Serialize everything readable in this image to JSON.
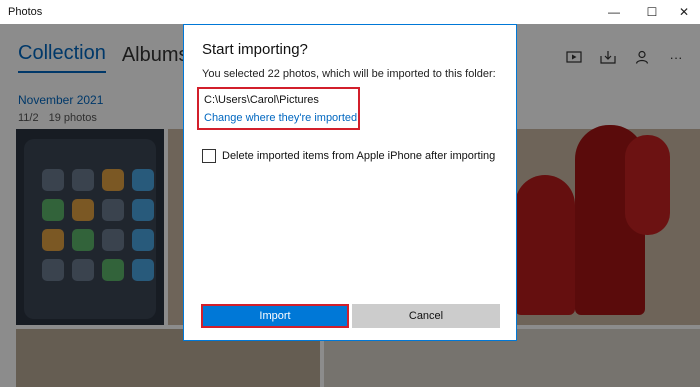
{
  "window": {
    "title": "Photos",
    "minimize_glyph": "—",
    "maximize_glyph": "☐",
    "close_glyph": "✕"
  },
  "nav": {
    "tabs": [
      {
        "label": "Collection",
        "active": true
      },
      {
        "label": "Albums",
        "active": false
      }
    ]
  },
  "toolbar": {
    "icons": [
      "slideshow-icon",
      "import-icon",
      "account-icon",
      "more-icon"
    ],
    "more_glyph": "···"
  },
  "collection": {
    "month": "November 2021",
    "date": "11/2",
    "count": "19 photos"
  },
  "dialog": {
    "title": "Start importing?",
    "subtitle": "You selected 22 photos, which will be imported to this folder:",
    "path": "C:\\Users\\Carol\\Pictures",
    "change_link": "Change where they're imported",
    "checkbox_label": "Delete imported items from Apple iPhone after importing",
    "checkbox_checked": false,
    "import_label": "Import",
    "cancel_label": "Cancel"
  },
  "colors": {
    "accent": "#0078d7",
    "link": "#0067c0",
    "highlight_border": "#d21f2b"
  }
}
